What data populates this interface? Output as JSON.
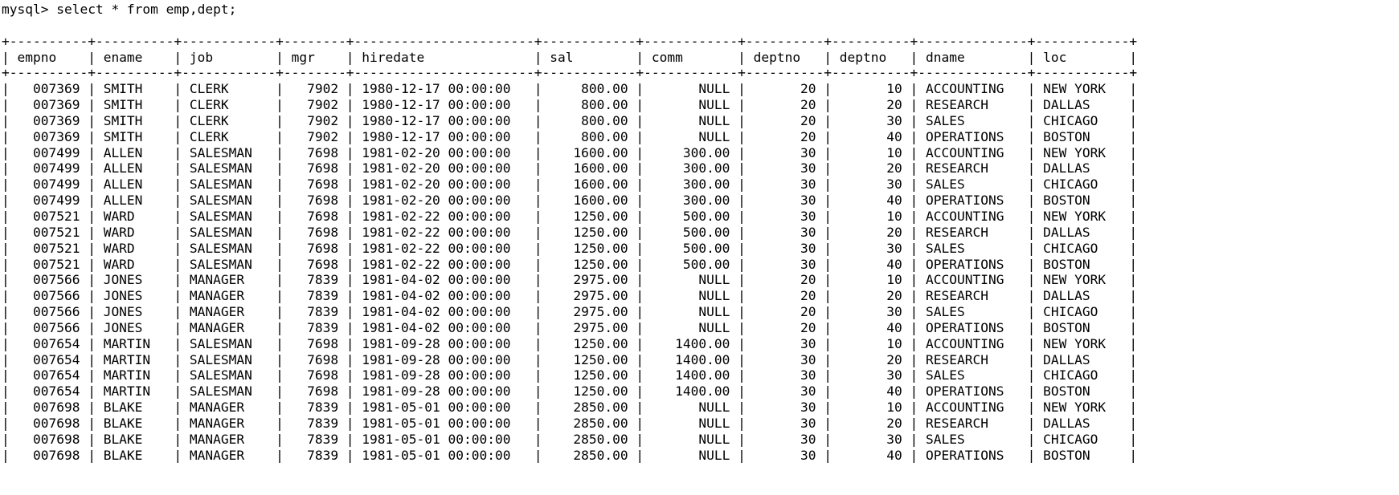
{
  "terminal": {
    "prompt": "mysql>",
    "command": "select * from emp,dept;",
    "prompt_line": "mysql> select * from emp,dept;"
  },
  "table": {
    "columns": [
      {
        "name": "empno",
        "width": 8,
        "align": "right"
      },
      {
        "name": "ename",
        "width": 8,
        "align": "left"
      },
      {
        "name": "job",
        "width": 10,
        "align": "left"
      },
      {
        "name": "mgr",
        "width": 6,
        "align": "right"
      },
      {
        "name": "hiredate",
        "width": 21,
        "align": "left"
      },
      {
        "name": "sal",
        "width": 10,
        "align": "right"
      },
      {
        "name": "comm",
        "width": 10,
        "align": "right"
      },
      {
        "name": "deptno",
        "width": 8,
        "align": "right"
      },
      {
        "name": "deptno",
        "width": 8,
        "align": "right"
      },
      {
        "name": "dname",
        "width": 12,
        "align": "left"
      },
      {
        "name": "loc",
        "width": 10,
        "align": "left"
      }
    ],
    "rows": [
      [
        "007369",
        "SMITH",
        "CLERK",
        "7902",
        "1980-12-17 00:00:00",
        "800.00",
        "NULL",
        "20",
        "10",
        "ACCOUNTING",
        "NEW YORK"
      ],
      [
        "007369",
        "SMITH",
        "CLERK",
        "7902",
        "1980-12-17 00:00:00",
        "800.00",
        "NULL",
        "20",
        "20",
        "RESEARCH",
        "DALLAS"
      ],
      [
        "007369",
        "SMITH",
        "CLERK",
        "7902",
        "1980-12-17 00:00:00",
        "800.00",
        "NULL",
        "20",
        "30",
        "SALES",
        "CHICAGO"
      ],
      [
        "007369",
        "SMITH",
        "CLERK",
        "7902",
        "1980-12-17 00:00:00",
        "800.00",
        "NULL",
        "20",
        "40",
        "OPERATIONS",
        "BOSTON"
      ],
      [
        "007499",
        "ALLEN",
        "SALESMAN",
        "7698",
        "1981-02-20 00:00:00",
        "1600.00",
        "300.00",
        "30",
        "10",
        "ACCOUNTING",
        "NEW YORK"
      ],
      [
        "007499",
        "ALLEN",
        "SALESMAN",
        "7698",
        "1981-02-20 00:00:00",
        "1600.00",
        "300.00",
        "30",
        "20",
        "RESEARCH",
        "DALLAS"
      ],
      [
        "007499",
        "ALLEN",
        "SALESMAN",
        "7698",
        "1981-02-20 00:00:00",
        "1600.00",
        "300.00",
        "30",
        "30",
        "SALES",
        "CHICAGO"
      ],
      [
        "007499",
        "ALLEN",
        "SALESMAN",
        "7698",
        "1981-02-20 00:00:00",
        "1600.00",
        "300.00",
        "30",
        "40",
        "OPERATIONS",
        "BOSTON"
      ],
      [
        "007521",
        "WARD",
        "SALESMAN",
        "7698",
        "1981-02-22 00:00:00",
        "1250.00",
        "500.00",
        "30",
        "10",
        "ACCOUNTING",
        "NEW YORK"
      ],
      [
        "007521",
        "WARD",
        "SALESMAN",
        "7698",
        "1981-02-22 00:00:00",
        "1250.00",
        "500.00",
        "30",
        "20",
        "RESEARCH",
        "DALLAS"
      ],
      [
        "007521",
        "WARD",
        "SALESMAN",
        "7698",
        "1981-02-22 00:00:00",
        "1250.00",
        "500.00",
        "30",
        "30",
        "SALES",
        "CHICAGO"
      ],
      [
        "007521",
        "WARD",
        "SALESMAN",
        "7698",
        "1981-02-22 00:00:00",
        "1250.00",
        "500.00",
        "30",
        "40",
        "OPERATIONS",
        "BOSTON"
      ],
      [
        "007566",
        "JONES",
        "MANAGER",
        "7839",
        "1981-04-02 00:00:00",
        "2975.00",
        "NULL",
        "20",
        "10",
        "ACCOUNTING",
        "NEW YORK"
      ],
      [
        "007566",
        "JONES",
        "MANAGER",
        "7839",
        "1981-04-02 00:00:00",
        "2975.00",
        "NULL",
        "20",
        "20",
        "RESEARCH",
        "DALLAS"
      ],
      [
        "007566",
        "JONES",
        "MANAGER",
        "7839",
        "1981-04-02 00:00:00",
        "2975.00",
        "NULL",
        "20",
        "30",
        "SALES",
        "CHICAGO"
      ],
      [
        "007566",
        "JONES",
        "MANAGER",
        "7839",
        "1981-04-02 00:00:00",
        "2975.00",
        "NULL",
        "20",
        "40",
        "OPERATIONS",
        "BOSTON"
      ],
      [
        "007654",
        "MARTIN",
        "SALESMAN",
        "7698",
        "1981-09-28 00:00:00",
        "1250.00",
        "1400.00",
        "30",
        "10",
        "ACCOUNTING",
        "NEW YORK"
      ],
      [
        "007654",
        "MARTIN",
        "SALESMAN",
        "7698",
        "1981-09-28 00:00:00",
        "1250.00",
        "1400.00",
        "30",
        "20",
        "RESEARCH",
        "DALLAS"
      ],
      [
        "007654",
        "MARTIN",
        "SALESMAN",
        "7698",
        "1981-09-28 00:00:00",
        "1250.00",
        "1400.00",
        "30",
        "30",
        "SALES",
        "CHICAGO"
      ],
      [
        "007654",
        "MARTIN",
        "SALESMAN",
        "7698",
        "1981-09-28 00:00:00",
        "1250.00",
        "1400.00",
        "30",
        "40",
        "OPERATIONS",
        "BOSTON"
      ],
      [
        "007698",
        "BLAKE",
        "MANAGER",
        "7839",
        "1981-05-01 00:00:00",
        "2850.00",
        "NULL",
        "30",
        "10",
        "ACCOUNTING",
        "NEW YORK"
      ],
      [
        "007698",
        "BLAKE",
        "MANAGER",
        "7839",
        "1981-05-01 00:00:00",
        "2850.00",
        "NULL",
        "30",
        "20",
        "RESEARCH",
        "DALLAS"
      ],
      [
        "007698",
        "BLAKE",
        "MANAGER",
        "7839",
        "1981-05-01 00:00:00",
        "2850.00",
        "NULL",
        "30",
        "30",
        "SALES",
        "CHICAGO"
      ],
      [
        "007698",
        "BLAKE",
        "MANAGER",
        "7839",
        "1981-05-01 00:00:00",
        "2850.00",
        "NULL",
        "30",
        "40",
        "OPERATIONS",
        "BOSTON"
      ]
    ]
  },
  "colors": {
    "background": "#ffffff",
    "foreground": "#000000"
  }
}
